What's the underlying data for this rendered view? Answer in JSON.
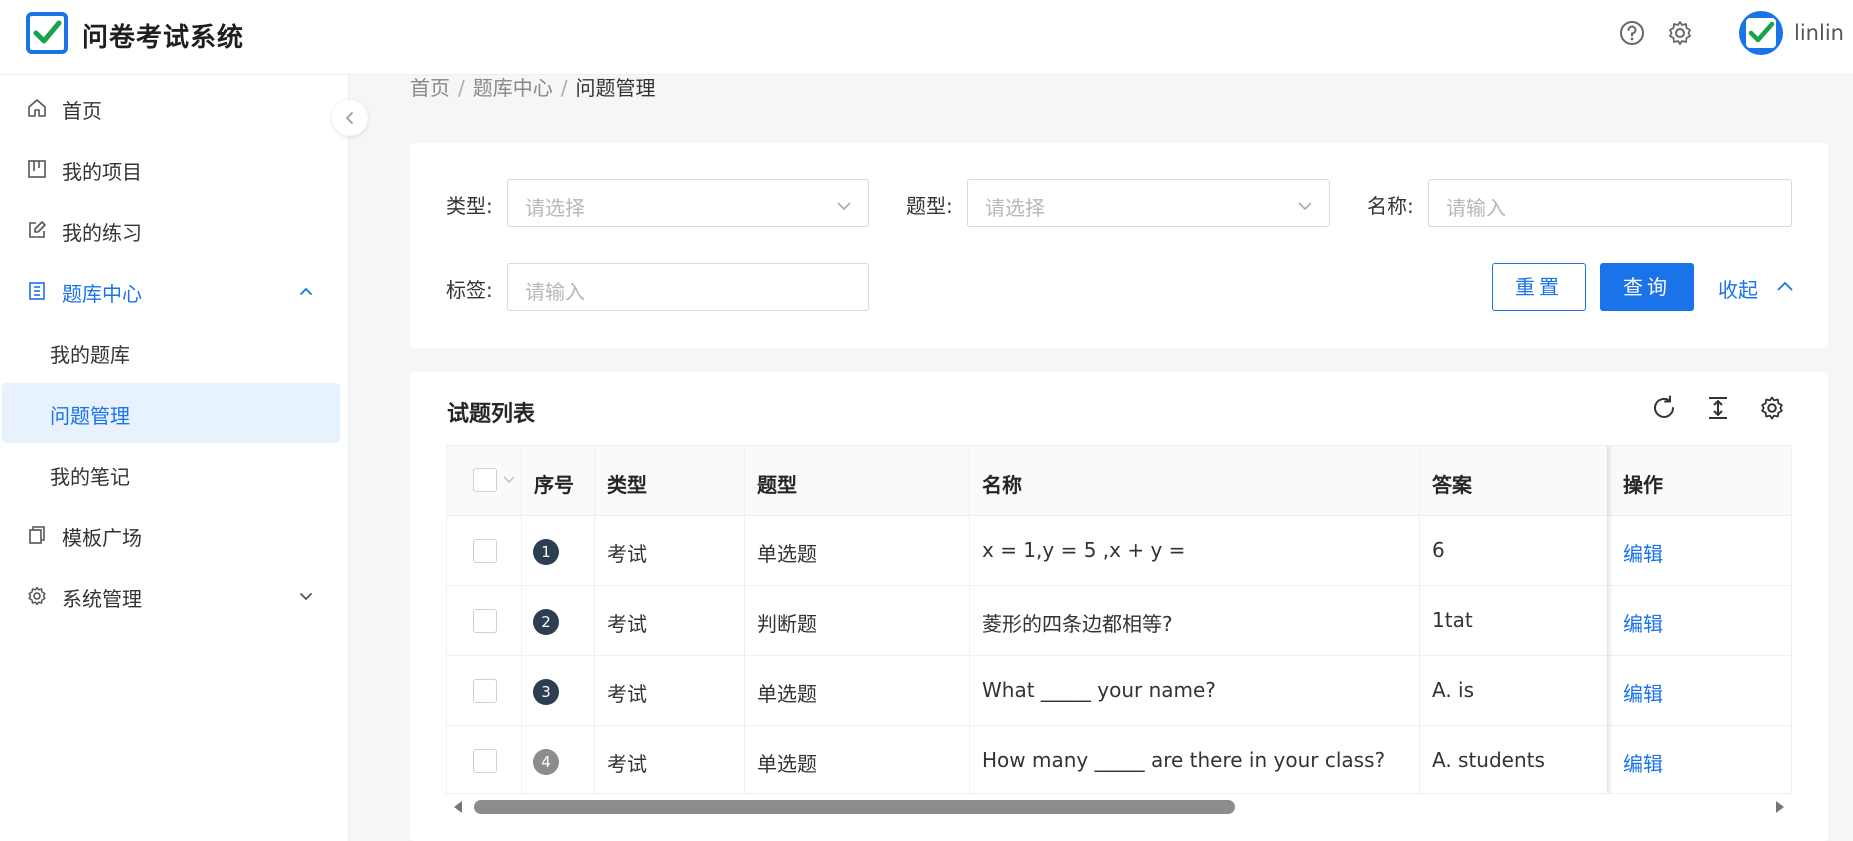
{
  "header": {
    "app_title": "问卷考试系统",
    "username": "linlin",
    "icons": [
      "help-icon",
      "gear-icon"
    ],
    "brand_color": "#1a73e8"
  },
  "sidebar": {
    "items": [
      {
        "label": "首页",
        "icon": "home-icon"
      },
      {
        "label": "我的项目",
        "icon": "project-icon"
      },
      {
        "label": "我的练习",
        "icon": "edit-icon"
      },
      {
        "label": "题库中心",
        "icon": "library-icon",
        "expanded": true
      },
      {
        "label": "我的题库"
      },
      {
        "label": "问题管理",
        "active": true
      },
      {
        "label": "我的笔记"
      },
      {
        "label": "模板广场",
        "icon": "template-icon"
      },
      {
        "label": "系统管理",
        "icon": "gear-icon",
        "expanded": false
      }
    ]
  },
  "breadcrumb": {
    "items": [
      "首页",
      "题库中心",
      "问题管理"
    ],
    "separator": "/"
  },
  "filters": {
    "type_label": "类型:",
    "type_placeholder": "请选择",
    "qtype_label": "题型:",
    "qtype_placeholder": "请选择",
    "name_label": "名称:",
    "name_placeholder": "请输入",
    "tag_label": "标签:",
    "tag_placeholder": "请输入",
    "reset_label": "重置",
    "search_label": "查询",
    "collapse_label": "收起"
  },
  "table": {
    "title": "试题列表",
    "columns": [
      "序号",
      "类型",
      "题型",
      "名称",
      "答案",
      "操作"
    ],
    "rows": [
      {
        "index": "1",
        "type": "考试",
        "qtype": "单选题",
        "name": "x = 1,y = 5 ,x + y =",
        "answer": "6",
        "action": "编辑"
      },
      {
        "index": "2",
        "type": "考试",
        "qtype": "判断题",
        "name": "菱形的四条边都相等?",
        "answer": "1tat",
        "action": "编辑"
      },
      {
        "index": "3",
        "type": "考试",
        "qtype": "单选题",
        "name": "What _____ your name?",
        "answer": "A. is",
        "action": "编辑"
      },
      {
        "index": "4",
        "type": "考试",
        "qtype": "单选题",
        "name": "How many _____ are there in your class?",
        "answer": "A. students",
        "action": "编辑"
      }
    ]
  }
}
